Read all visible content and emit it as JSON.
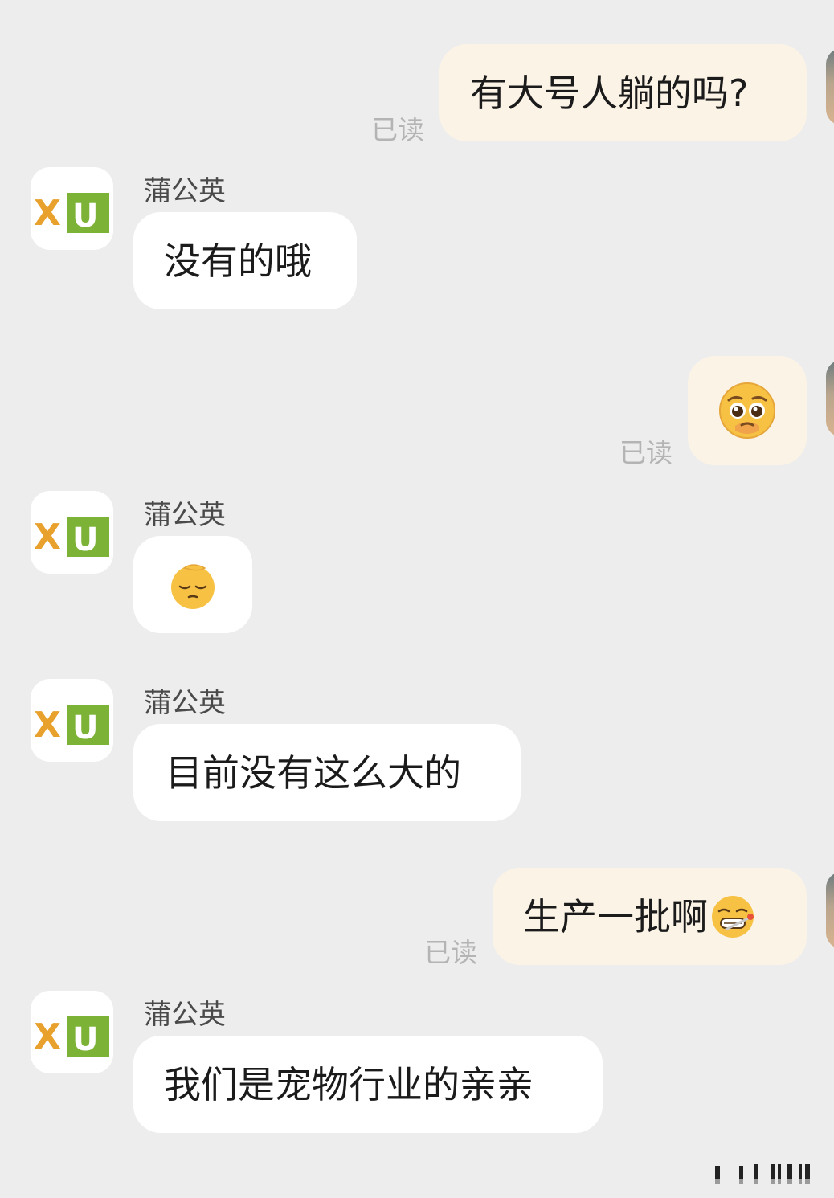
{
  "contact": {
    "name": "蒲公英",
    "avatar_text": "XU",
    "avatar_colors": {
      "x": "#e8a12c",
      "u_bg": "#7cb236",
      "u_fg": "#ffffff"
    }
  },
  "messages": [
    {
      "direction": "out",
      "text": "有大号人躺的吗?",
      "status": "已读"
    },
    {
      "direction": "in",
      "sender": "蒲公英",
      "text": "没有的哦"
    },
    {
      "direction": "out",
      "emoji": "pleading-face-icon",
      "status": "已读"
    },
    {
      "direction": "in",
      "sender": "蒲公英",
      "emoji": "sleepy-face-icon"
    },
    {
      "direction": "in",
      "sender": "蒲公英",
      "text": "目前没有这么大的"
    },
    {
      "direction": "out",
      "text": "生产一批啊",
      "emoji": "nauseated-face-icon",
      "status": "已读"
    },
    {
      "direction": "in",
      "sender": "蒲公英",
      "text": "我们是宠物行业的亲亲"
    }
  ],
  "colors": {
    "background": "#ededed",
    "outgoing_bubble": "#fbf3e6",
    "incoming_bubble": "#ffffff",
    "read_receipt": "#b4b4b4"
  }
}
